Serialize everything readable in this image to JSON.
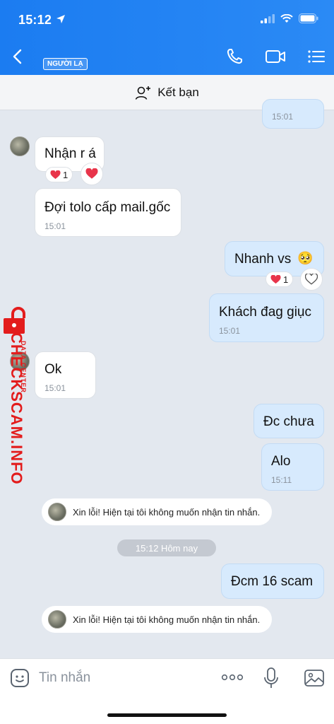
{
  "status_bar": {
    "time": "15:12"
  },
  "header": {
    "stranger_badge": "NGƯỜI LẠ"
  },
  "add_friend": {
    "label": "Kết bạn"
  },
  "messages": [
    {
      "id": "m0",
      "time": "15:01"
    },
    {
      "id": "m1",
      "text": "Nhận r á",
      "reaction_count": "1"
    },
    {
      "id": "m2",
      "text": "Đợi tolo cấp mail.gốc",
      "time": "15:01"
    },
    {
      "id": "m3",
      "text": "Nhanh vs",
      "emoji": "🥺",
      "reaction_count": "1"
    },
    {
      "id": "m4",
      "text": "Khách đag giục",
      "time": "15:01"
    },
    {
      "id": "m5",
      "text": "Ok",
      "time": "15:01"
    },
    {
      "id": "m6",
      "text": "Đc chưa"
    },
    {
      "id": "m7",
      "text": "Alo",
      "time": "15:11"
    },
    {
      "id": "m8",
      "text": "Đcm 16 scam"
    }
  ],
  "system_notices": [
    {
      "text": "Xin lỗi! Hiện tại tôi không muốn nhận tin nhắn."
    },
    {
      "text": "Xin lỗi! Hiện tại tôi không muốn nhận tin nhắn."
    }
  ],
  "date_separator": "15:12 Hôm nay",
  "watermark": {
    "main": "CHECKSCAM.INFO",
    "sub": "DATA CENTER"
  },
  "input": {
    "placeholder": "Tin nhắn",
    "more_label": "ooo"
  },
  "colors": {
    "header_blue": "#1b7cf1",
    "out_bubble": "#d7eafd",
    "heart": "#e8344a",
    "watermark_red": "#e31c1c"
  },
  "icons": [
    "location-arrow-icon",
    "signal-icon",
    "wifi-icon",
    "battery-icon",
    "back-icon",
    "phone-icon",
    "video-icon",
    "menu-icon",
    "add-person-icon",
    "heart-icon",
    "sticker-icon",
    "more-icon",
    "mic-icon",
    "image-icon",
    "lock-icon"
  ]
}
